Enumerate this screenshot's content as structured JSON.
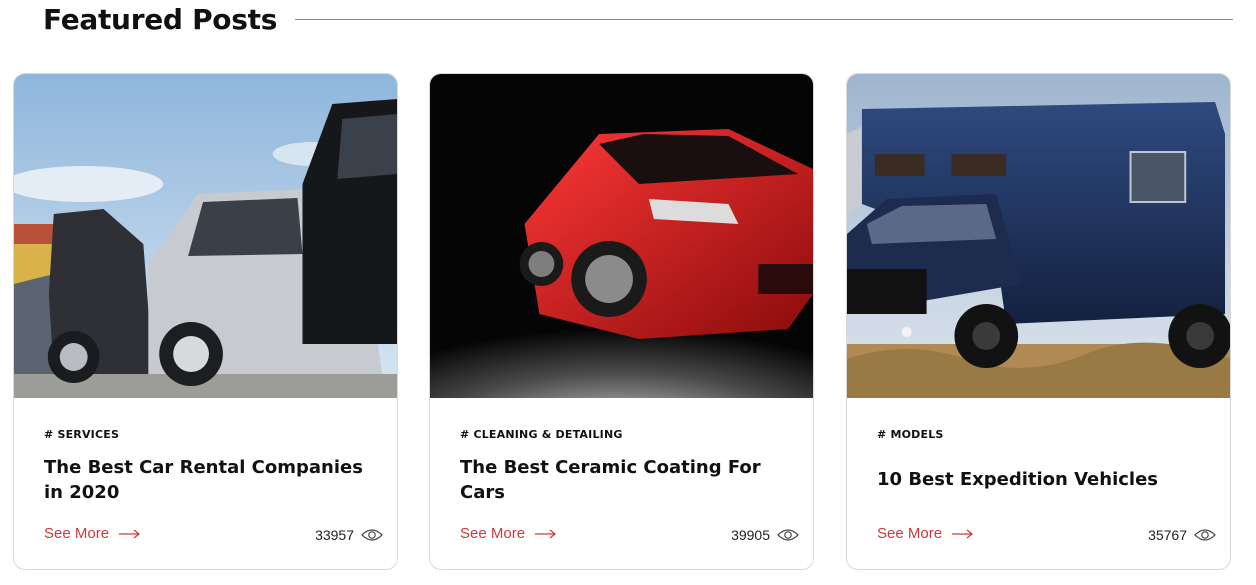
{
  "section": {
    "title": "Featured Posts"
  },
  "posts": [
    {
      "category": "# SERVICES",
      "title": "The Best Car Rental Companies in 2020",
      "see_more": "See More",
      "views": "33957",
      "image": "parked-cars-photo"
    },
    {
      "category": "# CLEANING & DETAILING",
      "title": "The Best Ceramic Coating For Cars",
      "see_more": "See More",
      "views": "39905",
      "image": "red-car-studio-photo"
    },
    {
      "category": "# MODELS",
      "title": "10 Best Expedition Vehicles",
      "see_more": "See More",
      "views": "35767",
      "image": "expedition-truck-photo"
    }
  ],
  "colors": {
    "accent": "#d0393b",
    "border": "#d9d9d9",
    "text": "#111111"
  },
  "icons": {
    "see_more": "arrow-right-icon",
    "views": "eye-icon"
  }
}
